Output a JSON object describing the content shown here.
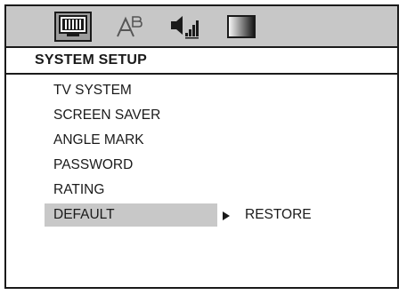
{
  "tabs": [
    {
      "icon": "monitor-icon",
      "selected": true
    },
    {
      "icon": "font-icon",
      "selected": false
    },
    {
      "icon": "speaker-icon",
      "selected": false
    },
    {
      "icon": "gradient-icon",
      "selected": false
    }
  ],
  "section": {
    "title": "SYSTEM SETUP"
  },
  "menu": {
    "items": [
      {
        "label": "TV SYSTEM"
      },
      {
        "label": "SCREEN SAVER"
      },
      {
        "label": "ANGLE MARK"
      },
      {
        "label": "PASSWORD"
      },
      {
        "label": "RATING"
      },
      {
        "label": "DEFAULT",
        "selected": true
      }
    ]
  },
  "submenu": {
    "label": "RESTORE"
  },
  "colors": {
    "tab_bar": "#c7c7c7",
    "selected_tab": "#9c9c9c",
    "highlight": "#c8c8c8",
    "border": "#1a1a1a"
  }
}
